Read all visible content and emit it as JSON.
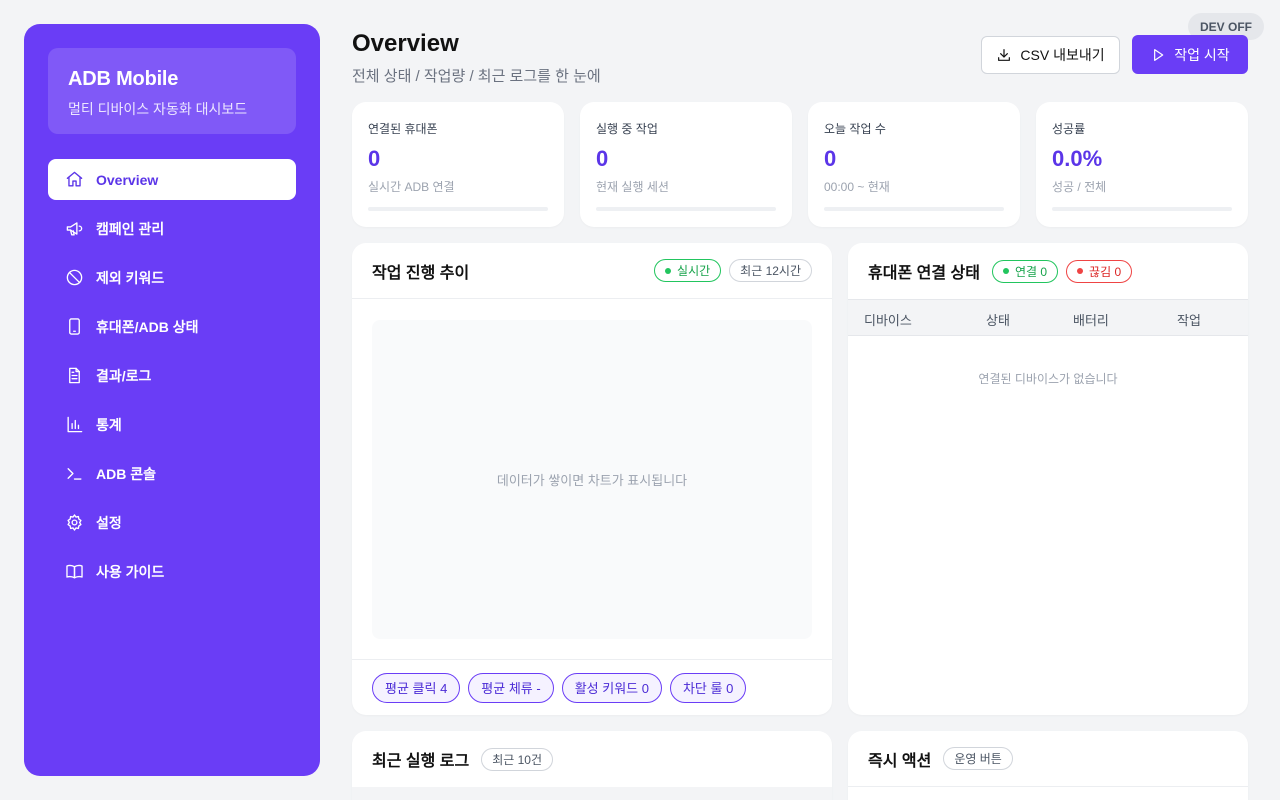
{
  "sidebar": {
    "brand_title": "ADB Mobile",
    "brand_sub": "멀티 디바이스 자동화 대시보드",
    "items": [
      {
        "label": "Overview",
        "icon": "home-icon",
        "active": true
      },
      {
        "label": "캠페인 관리",
        "icon": "megaphone-icon"
      },
      {
        "label": "제외 키워드",
        "icon": "ban-icon"
      },
      {
        "label": "휴대폰/ADB 상태",
        "icon": "phone-icon"
      },
      {
        "label": "결과/로그",
        "icon": "document-icon"
      },
      {
        "label": "통계",
        "icon": "bar-chart-icon"
      },
      {
        "label": "ADB 콘솔",
        "icon": "terminal-icon"
      },
      {
        "label": "설정",
        "icon": "gear-icon"
      },
      {
        "label": "사용 가이드",
        "icon": "book-icon"
      }
    ]
  },
  "header": {
    "title": "Overview",
    "subtitle": "전체 상태 / 작업량 / 최근 로그를 한 눈에",
    "csv_button": "CSV 내보내기",
    "start_button": "작업 시작",
    "dev_badge": "DEV OFF"
  },
  "stats": [
    {
      "label": "연결된 휴대폰",
      "value": "0",
      "desc": "실시간 ADB 연결",
      "progress": 0
    },
    {
      "label": "실행 중 작업",
      "value": "0",
      "desc": "현재 실행 세션",
      "progress": 0
    },
    {
      "label": "오늘 작업 수",
      "value": "0",
      "desc": "00:00 ~ 현재",
      "progress": 0
    },
    {
      "label": "성공률",
      "value": "0.0%",
      "desc": "성공 / 전체",
      "progress": 0
    }
  ],
  "progress_panel": {
    "title": "작업 진행 추이",
    "live_chip": "실시간",
    "range_chip": "최근 12시간",
    "empty_text": "데이터가 쌓이면 차트가 표시됩니다",
    "pills": [
      "평균 클릭 4",
      "평균 체류 -",
      "활성 키워드 0",
      "차단 룰 0"
    ]
  },
  "device_panel": {
    "title": "휴대폰 연결 상태",
    "connected_chip": "연결 0",
    "disconnected_chip": "끊김 0",
    "columns": [
      "디바이스",
      "상태",
      "배터리",
      "작업"
    ],
    "empty_text": "연결된 디바이스가 없습니다"
  },
  "log_panel": {
    "title": "최근 실행 로그",
    "count_chip": "최근 10건"
  },
  "action_panel": {
    "title": "즉시 액션",
    "chip": "운영 버튼"
  },
  "colors": {
    "accent": "#6a3df6",
    "accent_text": "#5b35e8",
    "success": "#22c55e",
    "danger": "#ef4444"
  }
}
